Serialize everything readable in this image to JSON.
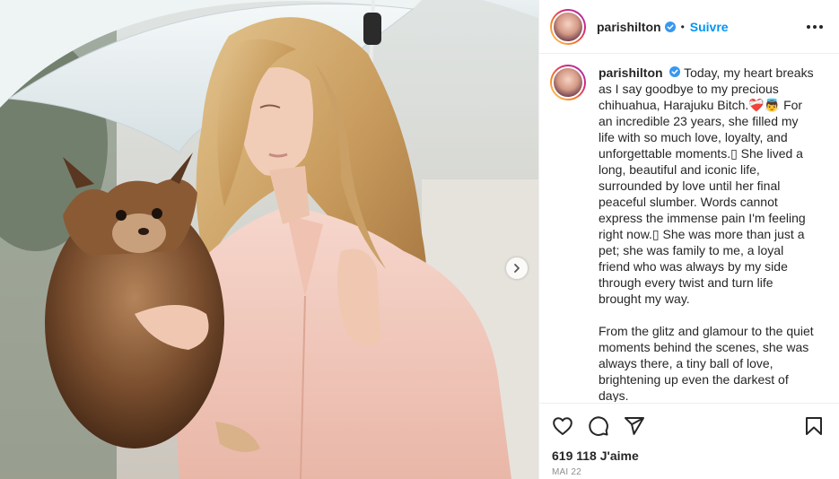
{
  "post": {
    "username": "parishilton",
    "separator": "•",
    "follow_label": "Suivre",
    "caption_paragraphs": [
      "Today, my heart breaks as I say goodbye to my precious chihuahua, Harajuku Bitch.❤️‍🩹👼 For an incredible 23 years, she filled my life with so much love, loyalty, and unforgettable moments.▯ She lived a long, beautiful and iconic life, surrounded by love until her final peaceful slumber. Words cannot express the immense pain I'm feeling right now.▯ She was more than just a pet; she was family to me, a loyal friend who was always by my side through every twist and turn life brought my way.",
      "From the glitz and glamour to the quiet moments behind the scenes, she was always there, a tiny ball of love, brightening up even the darkest of days."
    ],
    "likes_text": "619 118 J'aime",
    "date_text": "MAI 22"
  },
  "icons": {
    "verified": "verified-badge-icon",
    "more": "more-options-icon",
    "like": "heart-icon",
    "comment": "comment-icon",
    "share": "share-icon",
    "save": "bookmark-icon",
    "next": "chevron-right-icon"
  },
  "colors": {
    "accent": "#0095f6",
    "text": "#262626",
    "muted": "#8e8e8e",
    "verified": "#3897f0"
  }
}
